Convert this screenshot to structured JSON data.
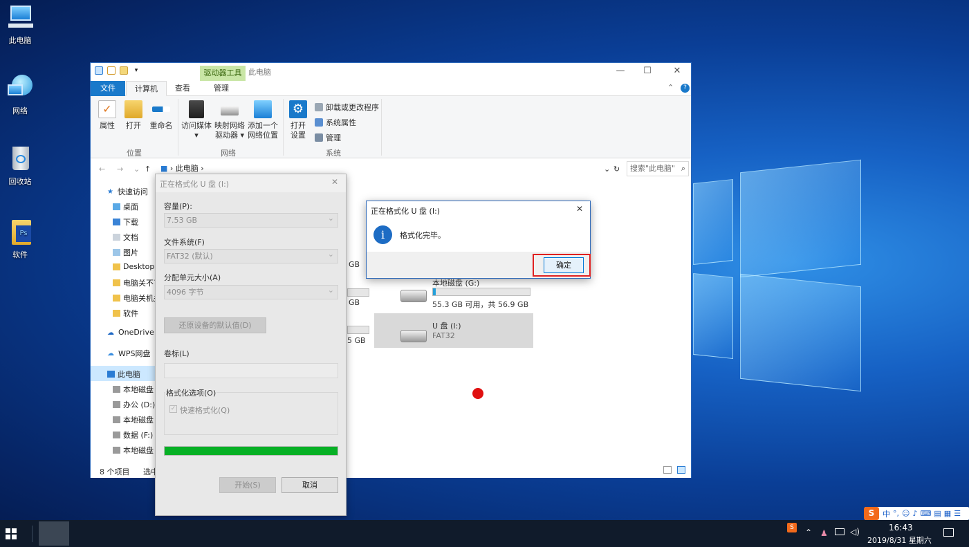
{
  "desktop": {
    "icons": [
      {
        "label": "此电脑",
        "icon": "computer-icon"
      },
      {
        "label": "网络",
        "icon": "network-icon"
      },
      {
        "label": "回收站",
        "icon": "recycle-bin-icon"
      },
      {
        "label": "软件",
        "icon": "folder-icon"
      }
    ]
  },
  "explorer": {
    "title": "此电脑",
    "context_tab": "驱动器工具",
    "tabs": {
      "file": "文件",
      "computer": "计算机",
      "view": "查看",
      "manage": "管理"
    },
    "ribbon": {
      "properties": "属性",
      "open": "打开",
      "rename": "重命名",
      "group_location": "位置",
      "access_media": "访问媒体",
      "map_drive_1": "映射网络",
      "map_drive_2": "驱动器",
      "add_location_1": "添加一个",
      "add_location_2": "网络位置",
      "group_network": "网络",
      "open_settings_1": "打开",
      "open_settings_2": "设置",
      "uninstall": "卸载或更改程序",
      "system_props": "系统属性",
      "manage": "管理",
      "group_system": "系统"
    },
    "address": "此电脑",
    "search_placeholder": "搜索\"此电脑\"",
    "nav": [
      {
        "label": "快速访问"
      },
      {
        "label": "桌面"
      },
      {
        "label": "下载"
      },
      {
        "label": "文档"
      },
      {
        "label": "图片"
      },
      {
        "label": "Desktop"
      },
      {
        "label": "电脑关不了"
      },
      {
        "label": "电脑关机关"
      },
      {
        "label": "软件"
      },
      {
        "label": "OneDrive"
      },
      {
        "label": "WPS网盘"
      },
      {
        "label": "此电脑"
      },
      {
        "label": "本地磁盘"
      },
      {
        "label": "办公 (D:)"
      },
      {
        "label": "本地磁盘"
      },
      {
        "label": "数据 (F:)"
      },
      {
        "label": "本地磁盘"
      }
    ],
    "drives": {
      "partial_1": "GB",
      "partial_2": "GB",
      "partial_3": "5 GB",
      "g_name": "本地磁盘 (G:)",
      "g_info": "55.3 GB 可用，共 56.9 GB",
      "g_used_fraction": 0.03,
      "i_name": "U 盘 (I:)",
      "i_fs": "FAT32"
    },
    "status": {
      "count": "8 个项目",
      "selected": "选中"
    }
  },
  "format_dialog": {
    "title": "正在格式化 U 盘 (I:)",
    "capacity_label": "容量(P):",
    "capacity_value": "7.53 GB",
    "fs_label": "文件系统(F)",
    "fs_value": "FAT32 (默认)",
    "alloc_label": "分配单元大小(A)",
    "alloc_value": "4096 字节",
    "restore_defaults": "还原设备的默认值(D)",
    "volume_label": "卷标(L)",
    "volume_value": "",
    "options_label": "格式化选项(O)",
    "quick_format": "快速格式化(Q)",
    "progress": 1.0,
    "start": "开始(S)",
    "cancel": "取消"
  },
  "message_box": {
    "title": "正在格式化 U 盘 (I:)",
    "text": "格式化完毕。",
    "ok": "确定"
  },
  "taskbar": {
    "time": "16:43",
    "date": "2019/8/31 星期六",
    "ime_lang": "中"
  }
}
